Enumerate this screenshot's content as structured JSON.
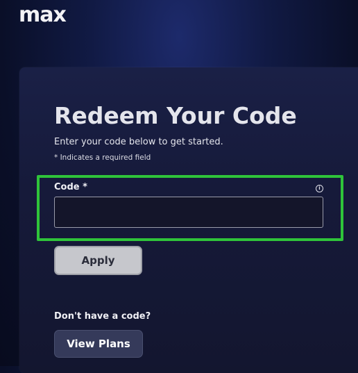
{
  "brand": {
    "logo_text": "max"
  },
  "form": {
    "title": "Redeem Your Code",
    "subtitle": "Enter your code below to get started.",
    "required_note": "* Indicates a required field",
    "code_label": "Code *",
    "code_value": "",
    "info_icon_glyph": "i",
    "apply_label": "Apply"
  },
  "footer": {
    "no_code_text": "Don't have a code?",
    "view_plans_label": "View Plans"
  },
  "colors": {
    "highlight": "#2fc43a",
    "background": "#0a0f28"
  },
  "icons": [
    "info-icon"
  ]
}
